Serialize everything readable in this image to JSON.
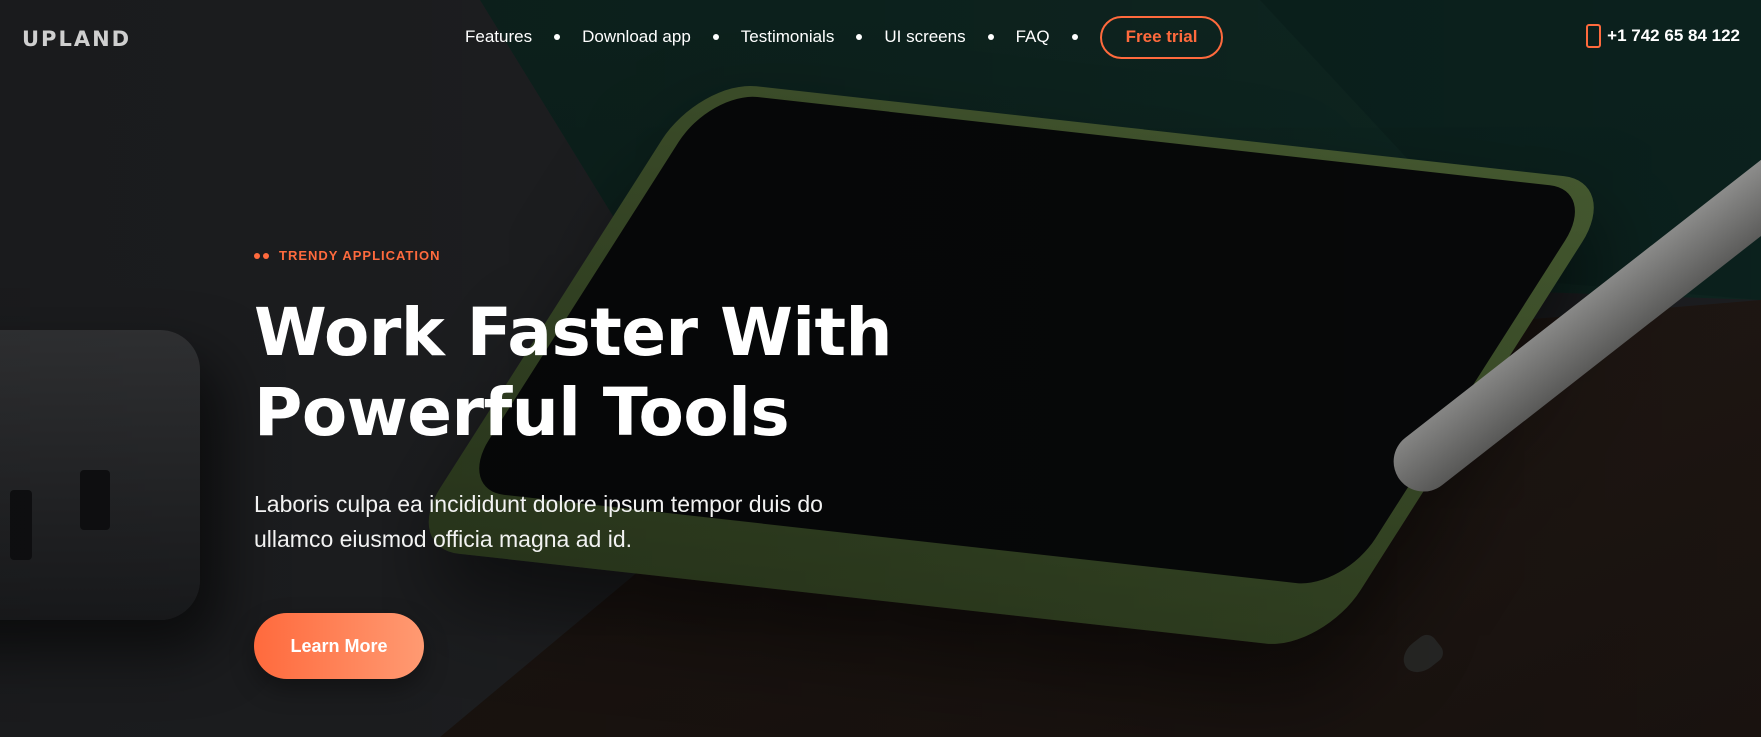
{
  "brand": {
    "logo_text": "UPLAND"
  },
  "nav": {
    "items": [
      {
        "label": "Features"
      },
      {
        "label": "Download app"
      },
      {
        "label": "Testimonials"
      },
      {
        "label": "UI screens"
      },
      {
        "label": "FAQ"
      }
    ],
    "trial_label": "Free trial"
  },
  "contact": {
    "phone": "+1 742 65 84 122",
    "icon": "phone-icon"
  },
  "hero": {
    "eyebrow": "TRENDY APPLICATION",
    "headline_line1": "Work Faster With",
    "headline_line2": "Powerful Tools",
    "subtext": "Laboris culpa ea incididunt dolore ipsum tempor duis do ullamco eiusmod officia magna ad id.",
    "cta_label": "Learn More"
  },
  "colors": {
    "accent": "#ff6a3d",
    "accent_light": "#ff9a72",
    "text": "#ffffff"
  }
}
